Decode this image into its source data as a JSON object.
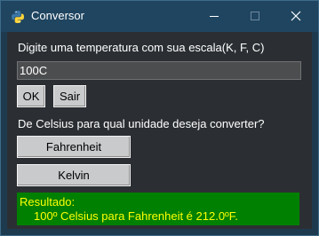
{
  "window": {
    "title": "Conversor",
    "app_icon": "python-icon",
    "controls": {
      "minimize_icon": "minimize-icon",
      "maximize_icon": "maximize-icon",
      "close_icon": "close-icon"
    }
  },
  "form": {
    "prompt": "Digite uma temperatura com sua escala(K, F, C)",
    "temperature_value": "100C",
    "ok_label": "OK",
    "exit_label": "Sair",
    "question": "De Celsius para qual unidade deseja converter?",
    "fahrenheit_label": "Fahrenheit",
    "kelvin_label": "Kelvin"
  },
  "result": {
    "title": "Resultado:",
    "text": "100º Celsius para Fahrenheit é 212.0ºF."
  },
  "colors": {
    "titlebar": "#1f4560",
    "background": "#2b2f33",
    "button": "#c9cacc",
    "input": "#4c4d4e",
    "result_background": "#008000",
    "result_text": "#ffff00"
  }
}
